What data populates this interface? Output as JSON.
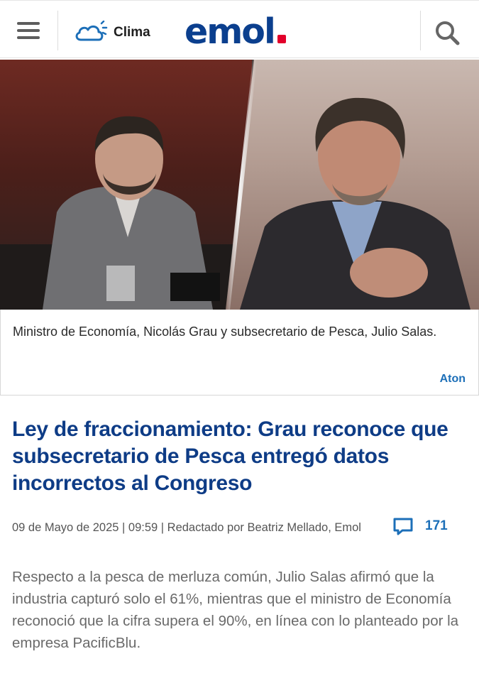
{
  "header": {
    "weather_label": "Clima",
    "logo": "emol",
    "brand_color": "#0b3f8e",
    "logo_dot_color": "#e2002b"
  },
  "photo": {
    "caption": "Ministro de Economía, Nicolás Grau y subsecretario de Pesca, Julio Salas.",
    "credit": "Aton"
  },
  "article": {
    "headline": "Ley de fraccionamiento: Grau reconoce que subsecretario de Pesca entregó datos incorrectos al Congreso",
    "meta": "09 de Mayo de 2025 | 09:59 | Redactado por Beatriz Mellado, Emol",
    "comment_count": "171",
    "lead": "Respecto a la pesca de merluza común, Julio Salas afirmó que la industria capturó solo el 61%, mientras que el ministro de Economía reconoció que la cifra supera el 90%, en línea con lo planteado por la empresa PacificBlu."
  },
  "icons": [
    "menu-icon",
    "cloud-sun-icon",
    "search-icon",
    "comment-icon"
  ]
}
